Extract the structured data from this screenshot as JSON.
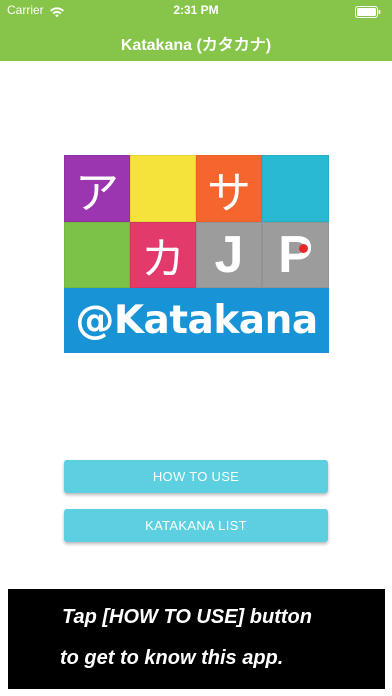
{
  "status_bar": {
    "carrier": "Carrier",
    "time": "2:31 PM",
    "icons": [
      "wifi-icon",
      "battery-icon"
    ]
  },
  "nav": {
    "title": "Katakana (カタカナ)"
  },
  "logo": {
    "tiles": [
      {
        "glyph": "ア",
        "color": "#9b35b0"
      },
      {
        "glyph": "",
        "color": "#f5e23a"
      },
      {
        "glyph": "サ",
        "color": "#f4662e"
      },
      {
        "glyph": "",
        "color": "#29b9d3"
      },
      {
        "glyph": "",
        "color": "#7cc246"
      },
      {
        "glyph": "カ",
        "color": "#e23a6b"
      },
      {
        "glyph": "J",
        "color": "#9c9c9c"
      },
      {
        "glyph": "P",
        "color": "#9c9c9c"
      }
    ],
    "band_text": "@Katakana",
    "band_color": "#1893d5",
    "accent_dot_color": "#e8272a"
  },
  "buttons": {
    "how_to_use": "HOW TO USE",
    "katakana_list": "KATAKANA LIST"
  },
  "banner": {
    "line1": "Tap [HOW TO USE] button",
    "line2": "to get to know this app."
  },
  "colors": {
    "header": "#86c54a",
    "button": "#5ccfe0",
    "banner_bg": "#000000"
  }
}
